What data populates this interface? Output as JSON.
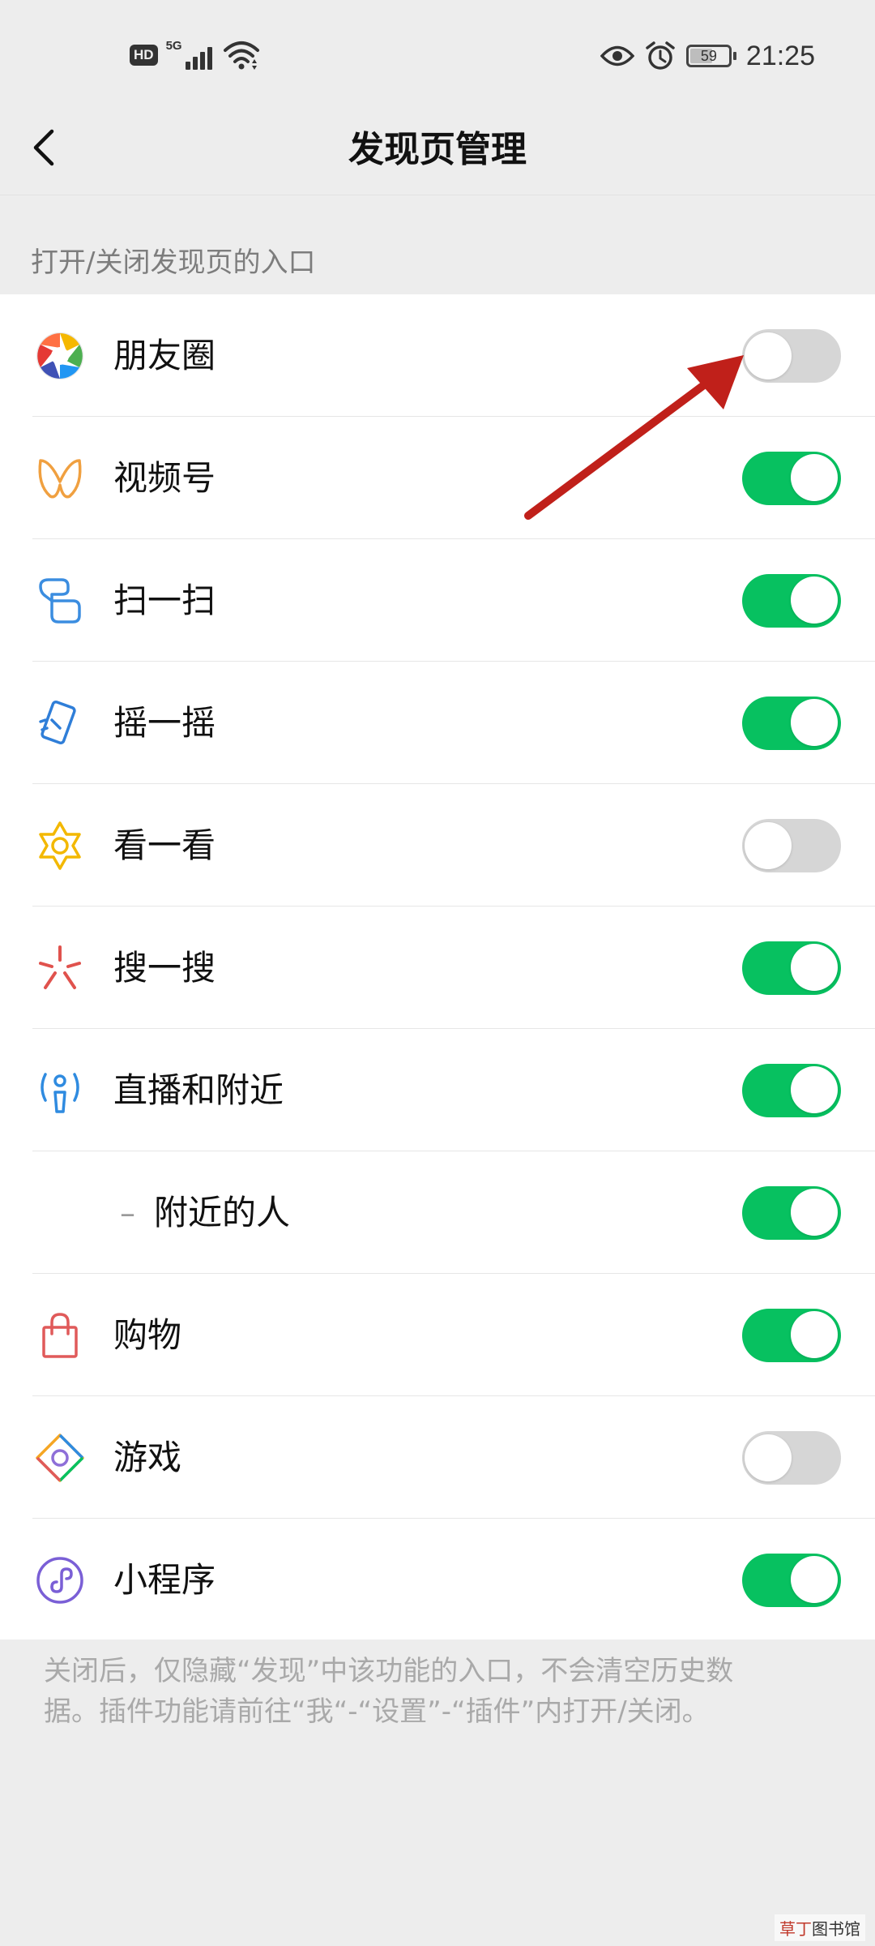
{
  "status_bar": {
    "hd_badge": "HD",
    "network": "5G",
    "battery": "59",
    "battery_level": 0.59,
    "time": "21:25",
    "icons": [
      "signal-icon",
      "wifi-icon",
      "eye-icon",
      "alarm-icon",
      "battery-icon"
    ]
  },
  "nav": {
    "title": "发现页管理",
    "back_icon": "chevron-left-icon"
  },
  "section": {
    "caption": "打开/关闭发现页的入口"
  },
  "items": [
    {
      "label": "朋友圈",
      "icon": "moments-aperture-icon",
      "enabled": false
    },
    {
      "label": "视频号",
      "icon": "channels-butterfly-icon",
      "enabled": true
    },
    {
      "label": "扫一扫",
      "icon": "scan-icon",
      "enabled": true
    },
    {
      "label": "摇一摇",
      "icon": "shake-phone-icon",
      "enabled": true
    },
    {
      "label": "看一看",
      "icon": "top-stories-star-icon",
      "enabled": false
    },
    {
      "label": "搜一搜",
      "icon": "search-sparkle-icon",
      "enabled": true
    },
    {
      "label": "直播和附近",
      "icon": "live-nearby-icon",
      "enabled": true
    },
    {
      "label": "附近的人",
      "prefix": "–",
      "icon": "",
      "enabled": true
    },
    {
      "label": "购物",
      "icon": "shopping-bag-icon",
      "enabled": true
    },
    {
      "label": "游戏",
      "icon": "games-diamond-icon",
      "enabled": false
    },
    {
      "label": "小程序",
      "icon": "mini-program-icon",
      "enabled": true
    }
  ],
  "footer": {
    "line1": "关闭后，仅隐藏“发现”中该功能的入口，不会清空历史数",
    "line2": "据。插件功能请前往“我“-“设置”-“插件”内打开/关闭。"
  },
  "watermark": {
    "part1": "草丁",
    "part2": "图书馆"
  },
  "colors": {
    "toggle_on": "#07c160",
    "toggle_off": "#d6d6d6",
    "annotation_arrow": "#c0201a",
    "background": "#ededed"
  }
}
